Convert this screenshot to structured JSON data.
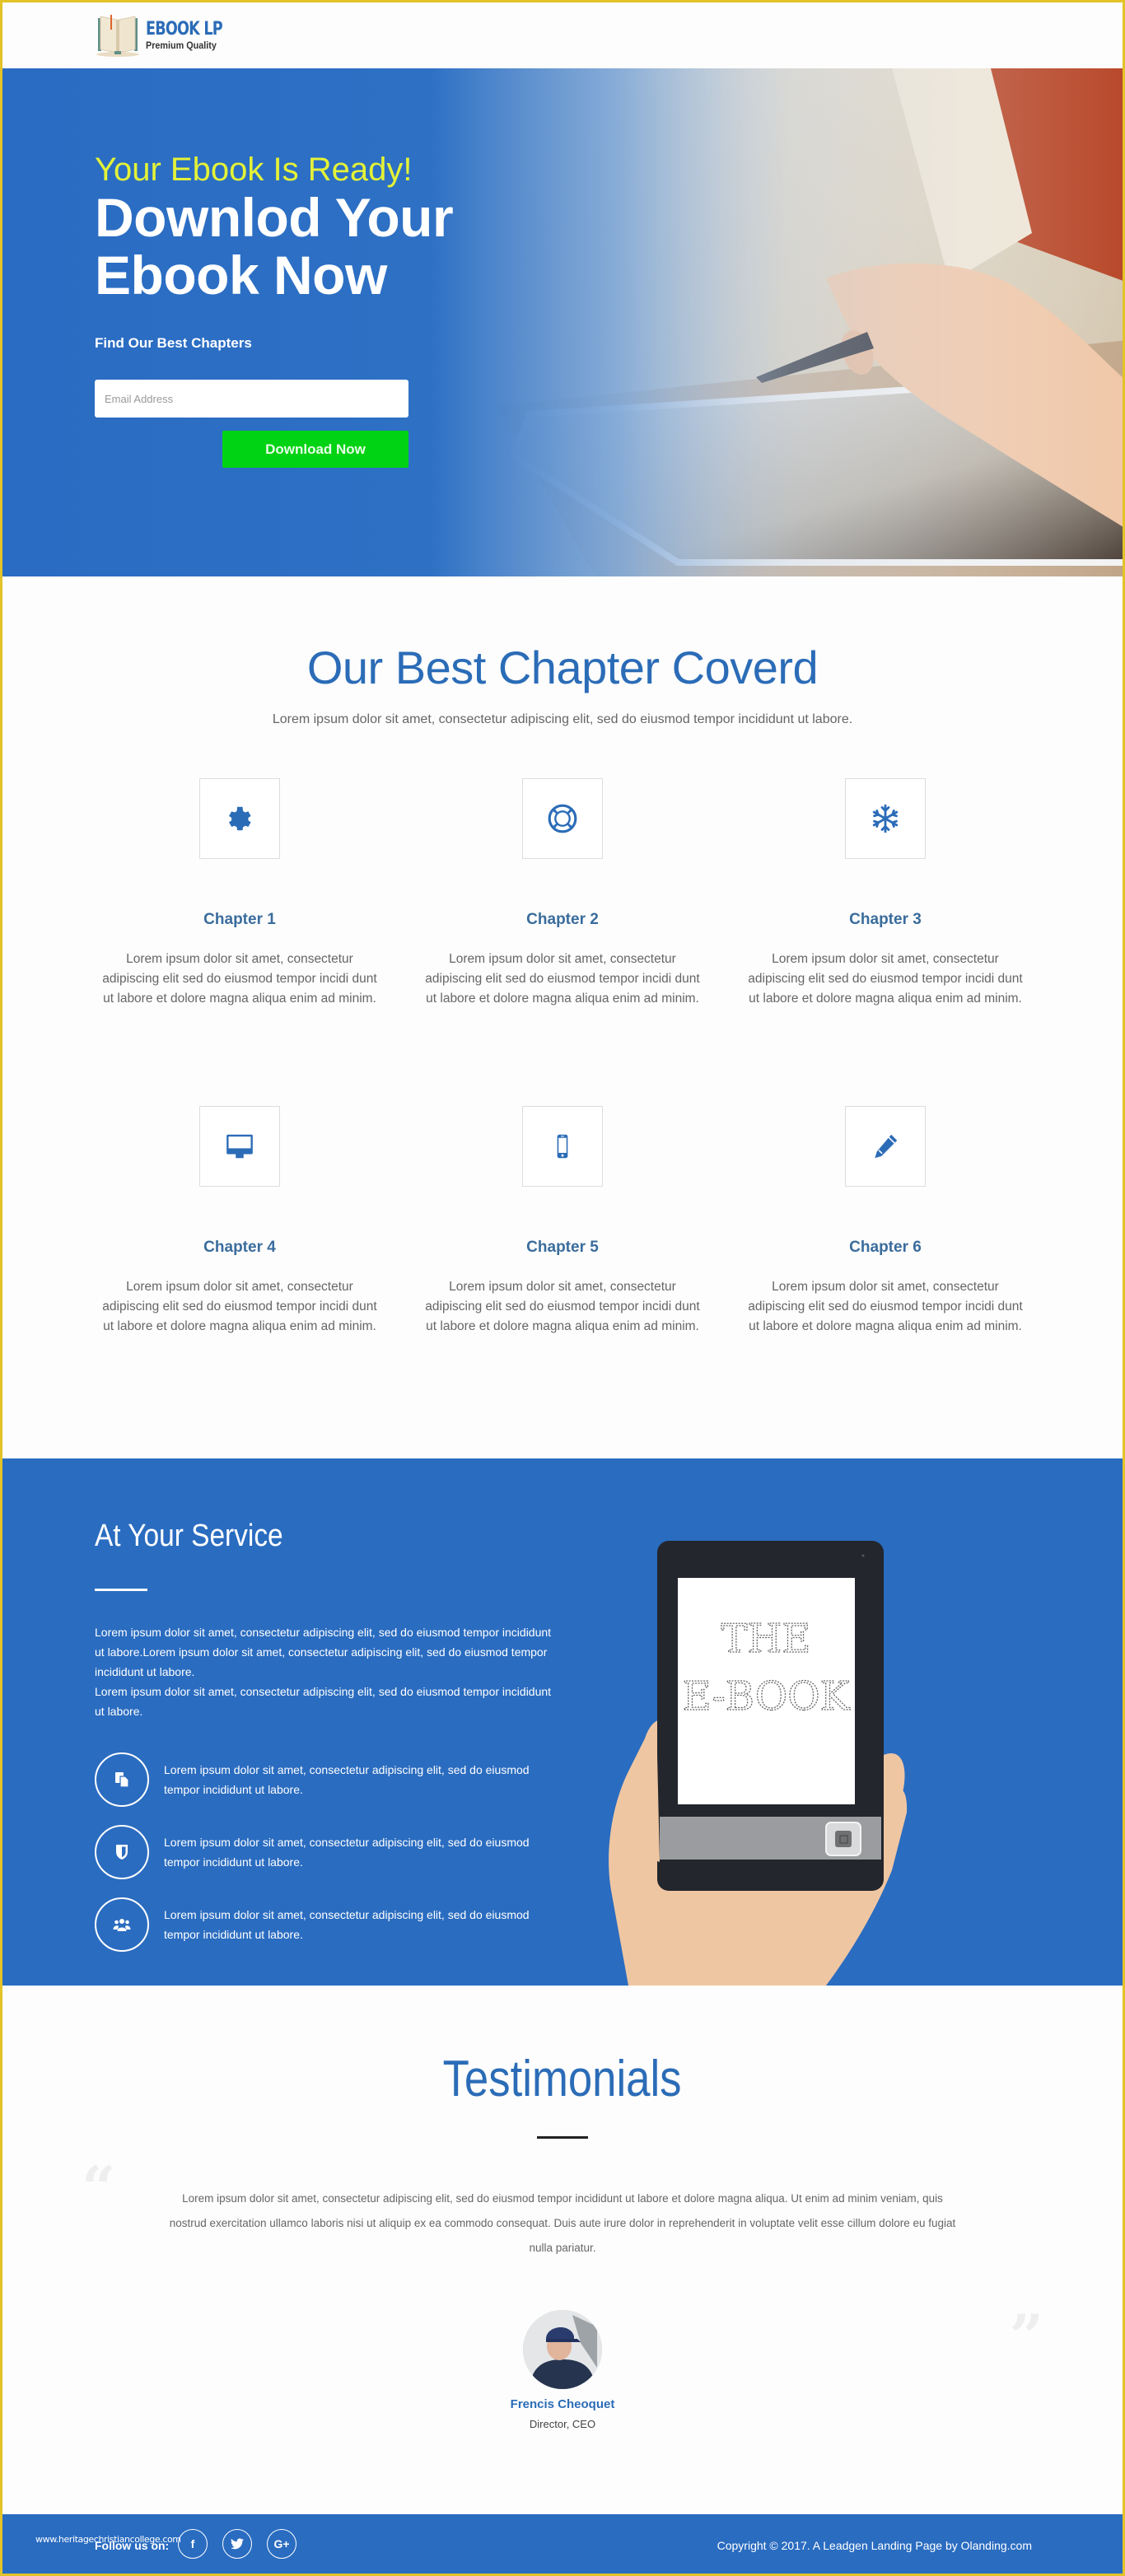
{
  "brand": {
    "title": "EBOOK LP",
    "subtitle": "Premium Quality"
  },
  "hero": {
    "kicker": "Your Ebook Is Ready!",
    "title_line1": "Downlod Your",
    "title_line2": "Ebook Now",
    "subtitle": "Find Our Best Chapters",
    "email_placeholder": "Email Address",
    "email_value": "",
    "button_label": "Download Now"
  },
  "chapters": {
    "title": "Our Best Chapter Coverd",
    "lead": "Lorem ipsum dolor sit amet, consectetur adipiscing elit, sed do eiusmod tempor incididunt ut labore.",
    "items": [
      {
        "icon": "gear-icon",
        "title": "Chapter 1",
        "text": "Lorem ipsum dolor sit amet, consectetur adipiscing elit sed do eiusmod tempor incidi dunt ut labore et dolore magna aliqua enim ad minim."
      },
      {
        "icon": "life-ring-icon",
        "title": "Chapter 2",
        "text": "Lorem ipsum dolor sit amet, consectetur adipiscing elit sed do eiusmod tempor incidi dunt ut labore et dolore magna aliqua enim ad minim."
      },
      {
        "icon": "snowflake-icon",
        "title": "Chapter 3",
        "text": "Lorem ipsum dolor sit amet, consectetur adipiscing elit sed do eiusmod tempor incidi dunt ut labore et dolore magna aliqua enim ad minim."
      },
      {
        "icon": "desktop-icon",
        "title": "Chapter 4",
        "text": "Lorem ipsum dolor sit amet, consectetur adipiscing elit sed do eiusmod tempor incidi dunt ut labore et dolore magna aliqua enim ad minim."
      },
      {
        "icon": "mobile-phone-icon",
        "title": "Chapter 5",
        "text": "Lorem ipsum dolor sit amet, consectetur adipiscing elit sed do eiusmod tempor incidi dunt ut labore et dolore magna aliqua enim ad minim."
      },
      {
        "icon": "pencil-icon",
        "title": "Chapter 6",
        "text": "Lorem ipsum dolor sit amet, consectetur adipiscing elit sed do eiusmod tempor incidi dunt ut labore et dolore magna aliqua enim ad minim."
      }
    ]
  },
  "service": {
    "title": "At Your Service",
    "paragraph1": "Lorem ipsum dolor sit amet, consectetur adipiscing elit, sed do eiusmod tempor incididunt ut labore.Lorem ipsum dolor sit amet, consectetur adipiscing elit, sed do eiusmod tempor incididunt ut labore.",
    "paragraph2": "Lorem ipsum dolor sit amet, consectetur adipiscing elit, sed do eiusmod tempor incididunt ut labore.",
    "items": [
      {
        "icon": "copy-files-icon",
        "text": "Lorem ipsum dolor sit amet, consectetur adipiscing elit, sed do eiusmod tempor incididunt ut labore."
      },
      {
        "icon": "shield-icon",
        "text": "Lorem ipsum dolor sit amet, consectetur adipiscing elit, sed do eiusmod tempor incididunt ut labore."
      },
      {
        "icon": "users-group-icon",
        "text": "Lorem ipsum dolor sit amet, consectetur adipiscing elit, sed do eiusmod tempor incididunt ut labore."
      }
    ],
    "ereader_screen_line1": "THE",
    "ereader_screen_line2": "E-BOOK"
  },
  "testimonials": {
    "title": "Testimonials",
    "quote_open": "“",
    "quote_close": "”",
    "text": "Lorem ipsum dolor sit amet, consectetur adipiscing elit, sed do eiusmod tempor incididunt ut labore et dolore magna aliqua. Ut enim ad minim veniam, quis nostrud exercitation ullamco laboris nisi ut aliquip ex ea commodo consequat. Duis aute irure dolor in reprehenderit in voluptate velit esse cillum dolore eu fugiat nulla pariatur.",
    "name": "Frencis Cheoquet",
    "role": "Director, CEO"
  },
  "footer": {
    "watermark": "www.heritagechristiancollege.com",
    "follow_label": "Follow us on:",
    "socials": [
      {
        "icon": "facebook-icon",
        "glyph": "f"
      },
      {
        "icon": "twitter-icon",
        "glyph": ""
      },
      {
        "icon": "google-plus-icon",
        "glyph": "G+"
      }
    ],
    "copyright": "Copyright © 2017. A Leadgen Landing Page by Olanding.com"
  },
  "colors": {
    "brand_blue": "#2b6cb7",
    "section_blue": "#2a6cc0",
    "cta_green": "#00d313",
    "kicker_yellow": "#e4f237",
    "frame_yellow": "#e3c327"
  }
}
